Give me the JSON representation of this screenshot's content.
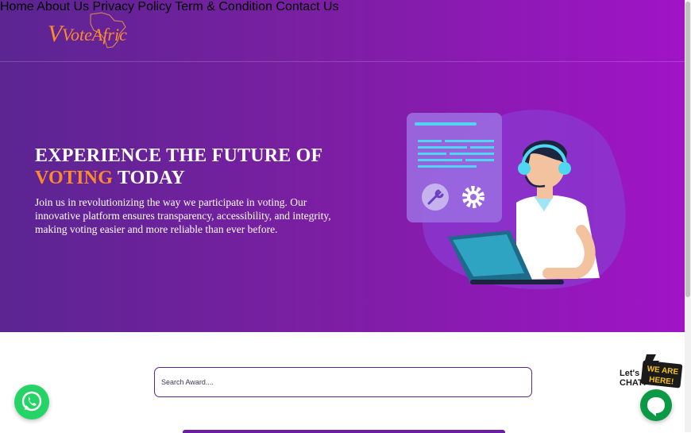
{
  "brand": {
    "logo_text": "VoteAfric",
    "colors": {
      "orange": "#ff8a2c",
      "purple_dark": "#5b2592",
      "purple_light": "#a014c6"
    }
  },
  "nav": {
    "items": [
      {
        "label": "Home"
      },
      {
        "label": "About Us"
      },
      {
        "label": "Privacy Policy"
      },
      {
        "label": "Term & Condition"
      },
      {
        "label": "Contact Us"
      }
    ]
  },
  "hero": {
    "headline_line1": "EXPERIENCE THE FUTURE OF",
    "headline_accent": "VOTING",
    "headline_rest": " TODAY",
    "description": "Join us in revolutionizing the way we participate in voting. Our innovative platform ensures transparency, accessibility, and integrity, making voting easier and more reliable than ever before.",
    "illustration": "support-agent-with-laptop"
  },
  "search": {
    "placeholder": "Search Award...."
  },
  "widgets": {
    "whatsapp_icon": "whatsapp-icon",
    "chat_badge": {
      "line1": "Let's",
      "line2": "CHAT!",
      "tag1": "WE ARE",
      "tag2": "HERE!"
    },
    "chat_icon": "chat-bubble-icon"
  }
}
